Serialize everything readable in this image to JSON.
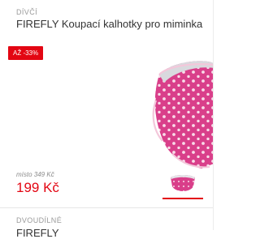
{
  "product": {
    "category": "DÍVČÍ",
    "title": "FIREFLY Koupací kalhotky pro miminka",
    "badge": "AŽ -33%",
    "original_price": "místo 349 Kč",
    "price": "199 Kč",
    "image": "pink-polka-dot-swim-diaper",
    "thumbnail": "pink-polka-dot-swim-diaper-thumb"
  },
  "next_product": {
    "category": "DVOUDÍLNÉ",
    "title": "FIREFLY"
  },
  "colors": {
    "accent": "#e30613",
    "fabric_pink": "#d93f8a"
  }
}
